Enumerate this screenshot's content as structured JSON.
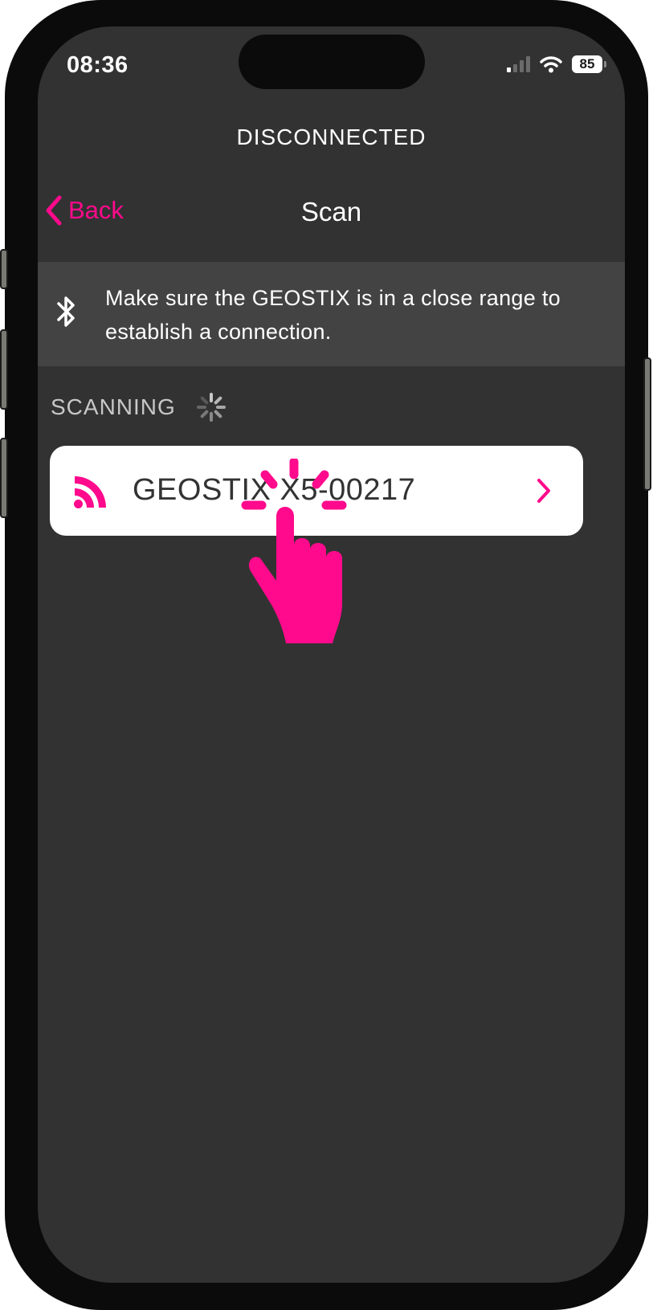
{
  "status_bar": {
    "time": "08:36",
    "battery": "85",
    "signal_bars_active": 1,
    "signal_bars_total": 4,
    "icons": [
      "cellular-signal-icon",
      "wifi-icon",
      "battery-icon"
    ]
  },
  "connection_status": "DISCONNECTED",
  "nav": {
    "back_label": "Back",
    "title": "Scan"
  },
  "info_banner": {
    "icon": "bluetooth-icon",
    "text": "Make sure the GEOSTIX is in a close range to establish a connection."
  },
  "scanning": {
    "label": "SCANNING",
    "icon": "loading-spinner-icon"
  },
  "devices": [
    {
      "name": "GEOSTIX X5-00217",
      "icon": "rss-signal-icon",
      "action_icon": "chevron-right-icon"
    }
  ],
  "overlay": {
    "icon": "tap-hand-icon"
  },
  "colors": {
    "accent": "#ff0a8c",
    "background": "#323232",
    "banner": "#434343",
    "card": "#ffffff",
    "text": "#ffffff",
    "device_text": "#333333",
    "muted_text": "#c8c8c8"
  }
}
